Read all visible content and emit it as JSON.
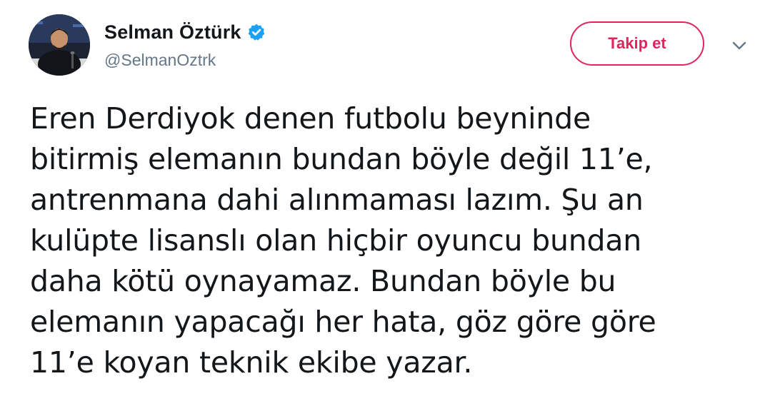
{
  "user": {
    "display_name": "Selman Öztürk",
    "handle": "@SelmanOztrk",
    "verified_icon": "verified-badge-icon",
    "avatar_icon": "profile-photo"
  },
  "actions": {
    "follow_label": "Takip et",
    "menu_icon": "chevron-down-icon"
  },
  "colors": {
    "follow_accent": "#e0245e",
    "verified_blue": "#1da1f2",
    "text_primary": "#14171a",
    "text_secondary": "#657786"
  },
  "tweet": {
    "text": "Eren Derdiyok denen futbolu beyninde\nbitirmiş elemanın bundan böyle değil 11’e,\nantrenmana dahi alınmaması lazım. Şu an\nkulüpte lisanslı olan hiçbir oyuncu bundan\ndaha kötü oynayamaz. Bundan böyle bu\nelemanın yapacağı her hata, göz göre göre\n11’e koyan teknik ekibe yazar."
  }
}
